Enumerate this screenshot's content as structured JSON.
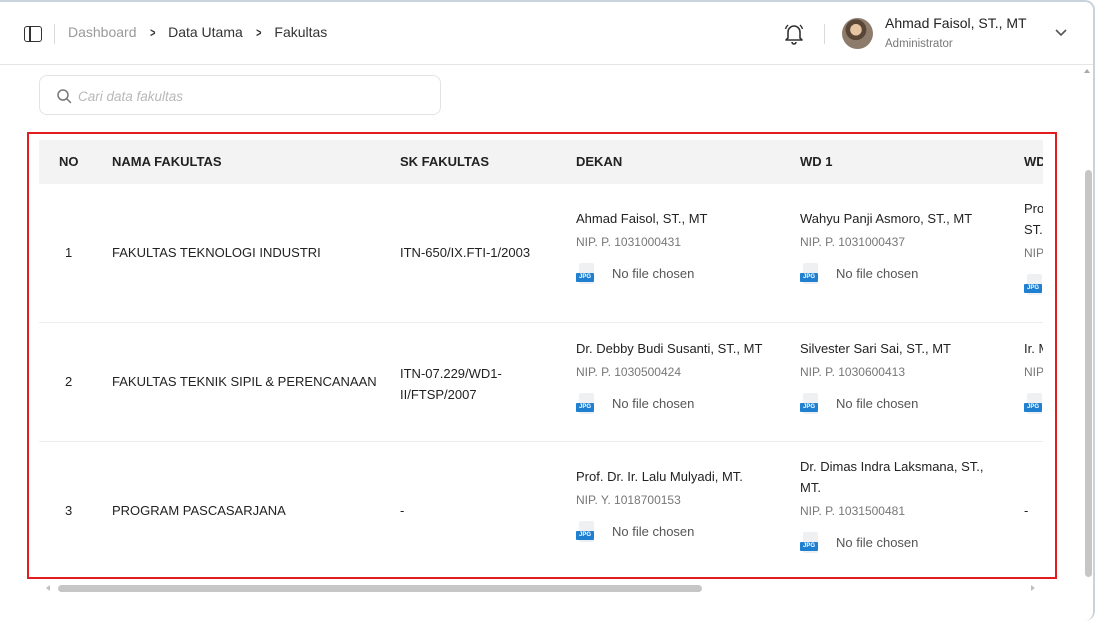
{
  "breadcrumb": [
    "Dashboard",
    "Data Utama",
    "Fakultas"
  ],
  "user": {
    "name": "Ahmad Faisol, ST., MT",
    "role": "Administrator"
  },
  "search": {
    "placeholder": "Cari data fakultas",
    "value": ""
  },
  "table": {
    "headers": [
      "NO",
      "NAMA FAKULTAS",
      "SK FAKULTAS",
      "DEKAN",
      "WD 1",
      "WD"
    ],
    "rows": [
      {
        "no": "1",
        "nama": "FAKULTAS TEKNOLOGI INDUSTRI",
        "sk": "ITN-650/IX.FTI-1/2003",
        "dekan": {
          "name": "Ahmad Faisol, ST., MT",
          "nip": "NIP. P. 1031000431",
          "file": "No file chosen"
        },
        "wd1": {
          "name": "Wahyu Panji Asmoro, ST., MT",
          "nip": "NIP. P. 1031000437",
          "file": "No file chosen"
        },
        "wd2": {
          "name": "Pro",
          "name2": "ST.",
          "nip": "NIP"
        }
      },
      {
        "no": "2",
        "nama": "FAKULTAS TEKNIK SIPIL & PERENCANAAN",
        "sk": "ITN-07.229/WD1-II/FTSP/2007",
        "dekan": {
          "name": "Dr. Debby Budi Susanti, ST., MT",
          "nip": "NIP. P. 1030500424",
          "file": "No file chosen"
        },
        "wd1": {
          "name": "Silvester Sari Sai, ST., MT",
          "nip": "NIP. P. 1030600413",
          "file": "No file chosen"
        },
        "wd2": {
          "name": "Ir. M",
          "nip": "NIP"
        }
      },
      {
        "no": "3",
        "nama": "PROGRAM PASCASARJANA",
        "sk": "-",
        "dekan": {
          "name": "Prof. Dr. Ir. Lalu Mulyadi, MT.",
          "nip": "NIP. Y. 1018700153",
          "file": "No file chosen"
        },
        "wd1": {
          "name": "Dr. Dimas Indra Laksmana, ST., MT.",
          "nip": "NIP. P. 1031500481",
          "file": "No file chosen"
        },
        "wd2": {
          "name": "-"
        }
      }
    ]
  },
  "file_icon_label": "JPG",
  "colors": {
    "highlight": "#e11d1d",
    "jpg_badge": "#1f7fd1",
    "header_bg": "#f3f3f3"
  }
}
